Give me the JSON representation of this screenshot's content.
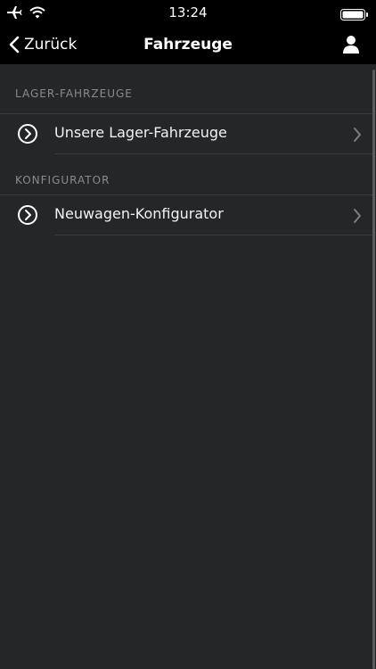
{
  "status_bar": {
    "time": "13:24"
  },
  "nav": {
    "back_label": "Zurück",
    "title": "Fahrzeuge"
  },
  "sections": [
    {
      "header": "LAGER-FAHRZEUGE",
      "items": [
        {
          "label": "Unsere Lager-Fahrzeuge"
        }
      ]
    },
    {
      "header": "KONFIGURATOR",
      "items": [
        {
          "label": "Neuwagen-Konfigurator"
        }
      ]
    }
  ],
  "colors": {
    "background": "#252628",
    "bar": "#000000",
    "header_text": "#8a8b8e",
    "separator": "#3a3b3e"
  }
}
